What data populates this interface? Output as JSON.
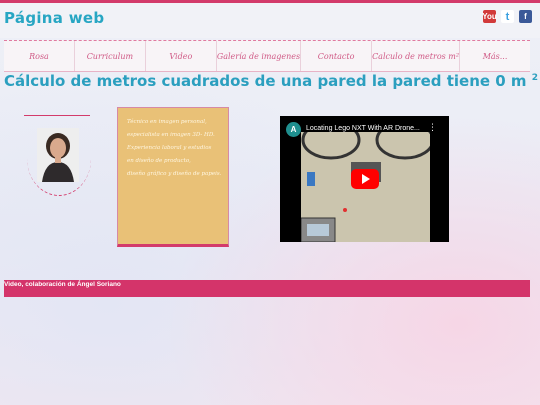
{
  "header": {
    "site_title": "Página web",
    "social": [
      {
        "icon": "youtube-icon",
        "glyph": "You",
        "color": "#d23a3a"
      },
      {
        "icon": "twitter-icon",
        "glyph": "t",
        "color": "#3aa0e0"
      },
      {
        "icon": "facebook-icon",
        "glyph": "f",
        "color": "#3b5998"
      }
    ]
  },
  "nav": {
    "items": [
      "Rosa",
      "Curriculum",
      "Video",
      "Galería de imagenes",
      "Contacto",
      "Calculo de metros m²",
      "Más..."
    ]
  },
  "main": {
    "heading": "Cálculo de metros cuadrados de una pared la pared tiene 0 m",
    "heading_sup": "2"
  },
  "profile_card": {
    "lines": [
      "Técnico en imagen personal,",
      "especialista en imagen 3D- HD.",
      "Experiencia laboral y estudios",
      "en diseño de producto,",
      "diseño gráfico y diseño de papeis."
    ]
  },
  "video": {
    "channel_initial": "A",
    "title": "Locating Lego NXT With AR Drone...",
    "menu_glyph": "⋮"
  },
  "caption": {
    "text": "Video, colaboración de Ángel Soriano"
  },
  "colors": {
    "accent": "#d33b6b",
    "title_blue": "#27a6c3",
    "card_yellow": "#e9c177"
  }
}
